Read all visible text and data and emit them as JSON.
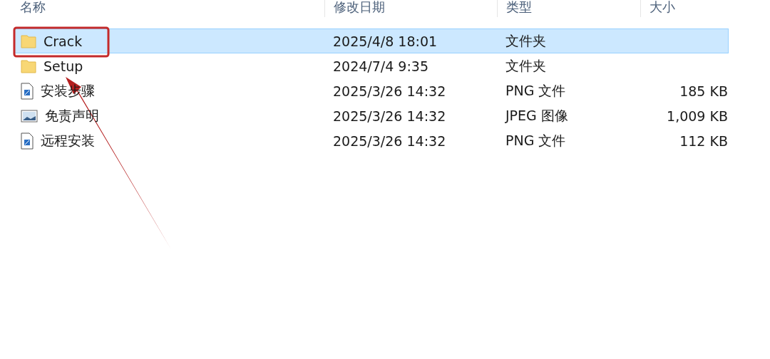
{
  "columns": [
    {
      "label": "名称"
    },
    {
      "label": "修改日期"
    },
    {
      "label": "类型"
    },
    {
      "label": "大小"
    }
  ],
  "rows": [
    {
      "kind": "folder",
      "name": "Crack",
      "date": "2025/4/8 18:01",
      "type": "文件夹",
      "selected": true
    },
    {
      "kind": "folder",
      "name": "Setup",
      "date": "2024/7/4 9:35",
      "type": "文件夹",
      "selected": false
    },
    {
      "kind": "png",
      "name": "安装步骤",
      "date": "2025/3/26 14:32",
      "type": "PNG 文件",
      "size": "185 KB",
      "selected": false
    },
    {
      "kind": "jpeg",
      "name": "免责声明",
      "date": "2025/3/26 14:32",
      "type": "JPEG 图像",
      "size": "1,009 KB",
      "selected": false
    },
    {
      "kind": "png",
      "name": "远程安装",
      "date": "2025/3/26 14:32",
      "type": "PNG 文件",
      "size": "112 KB",
      "selected": false
    }
  ]
}
